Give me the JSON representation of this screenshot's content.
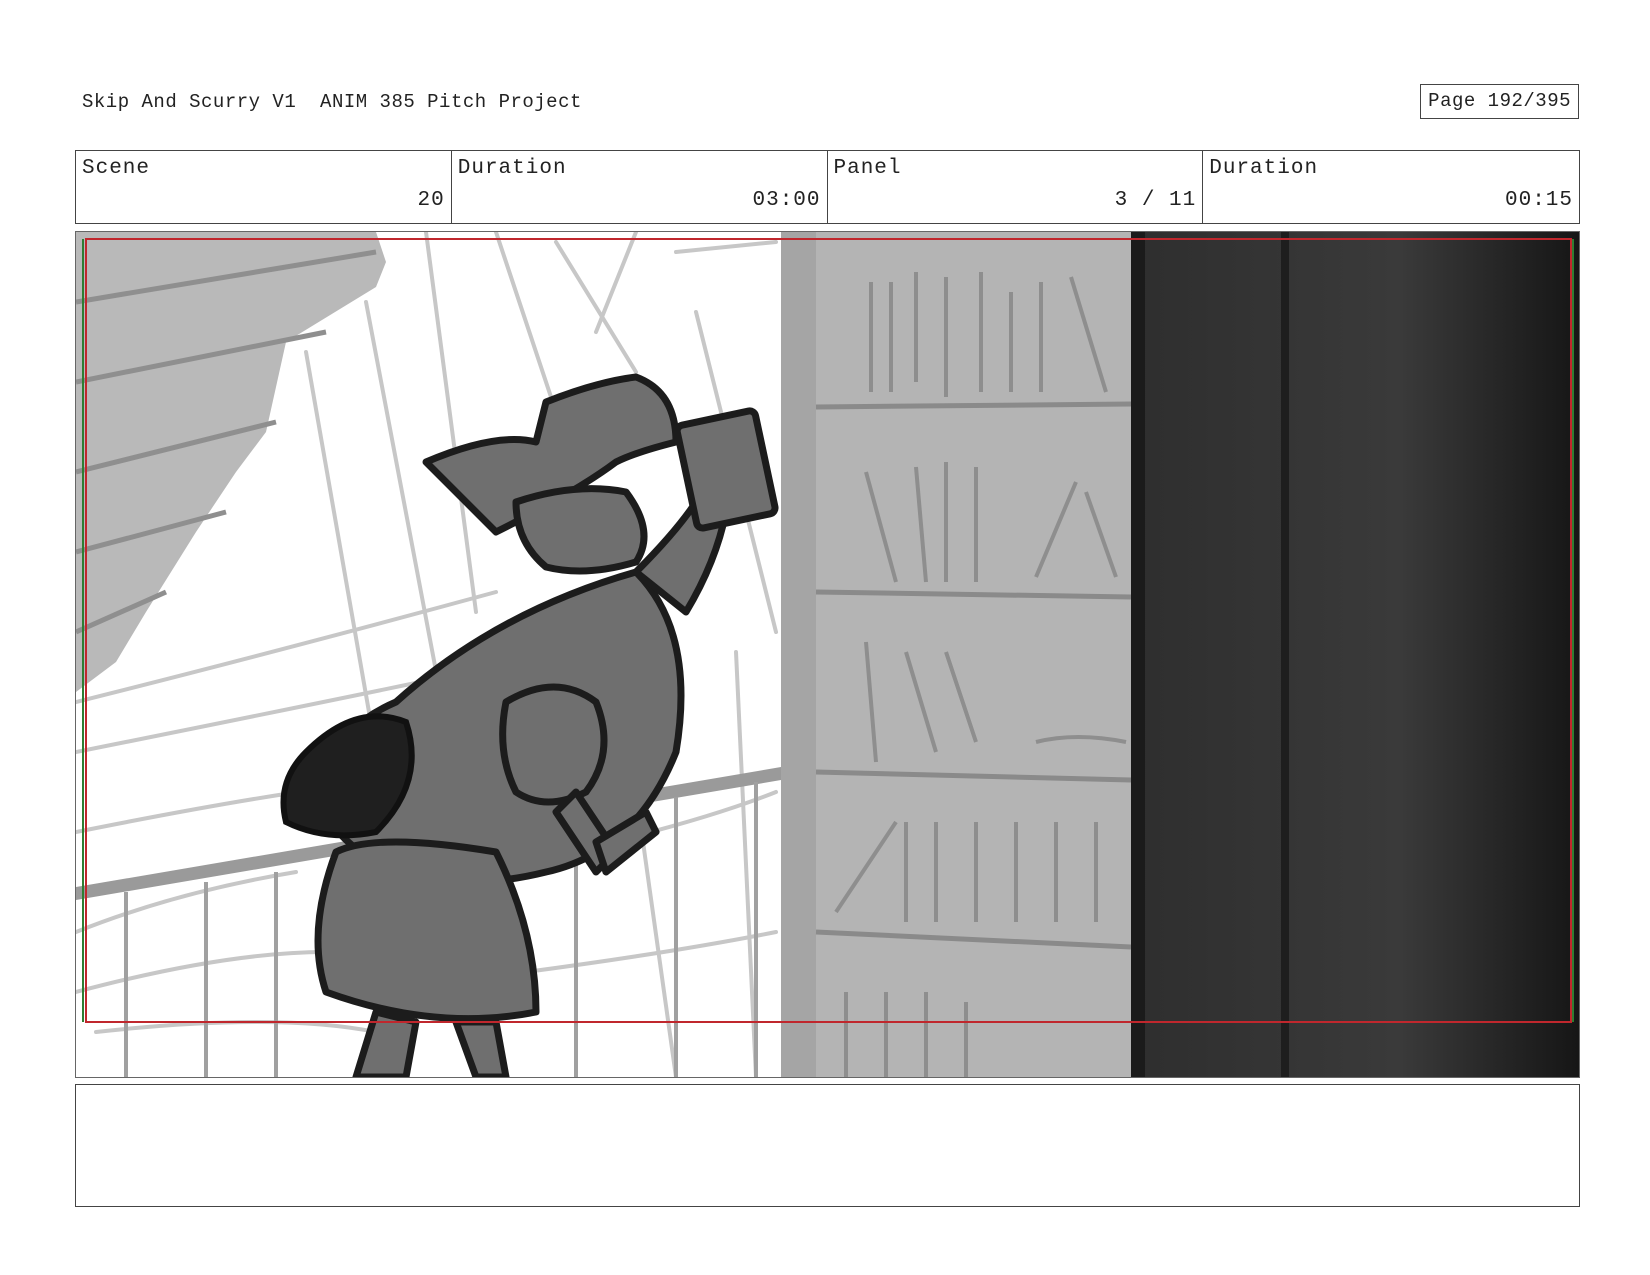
{
  "header": {
    "title": "Skip And Scurry V1  ANIM 385 Pitch Project",
    "page": "Page 192/395"
  },
  "info": {
    "scene_label": "Scene",
    "scene_value": "20",
    "scene_duration_label": "Duration",
    "scene_duration_value": "03:00",
    "panel_label": "Panel",
    "panel_value": "3 / 11",
    "panel_duration_label": "Duration",
    "panel_duration_value": "00:15"
  },
  "frame": {
    "description_icon": "storyboard-sketch",
    "safe_area_color": "#c0272d",
    "guide_color": "#2e7d32"
  },
  "notes": {
    "text": ""
  }
}
